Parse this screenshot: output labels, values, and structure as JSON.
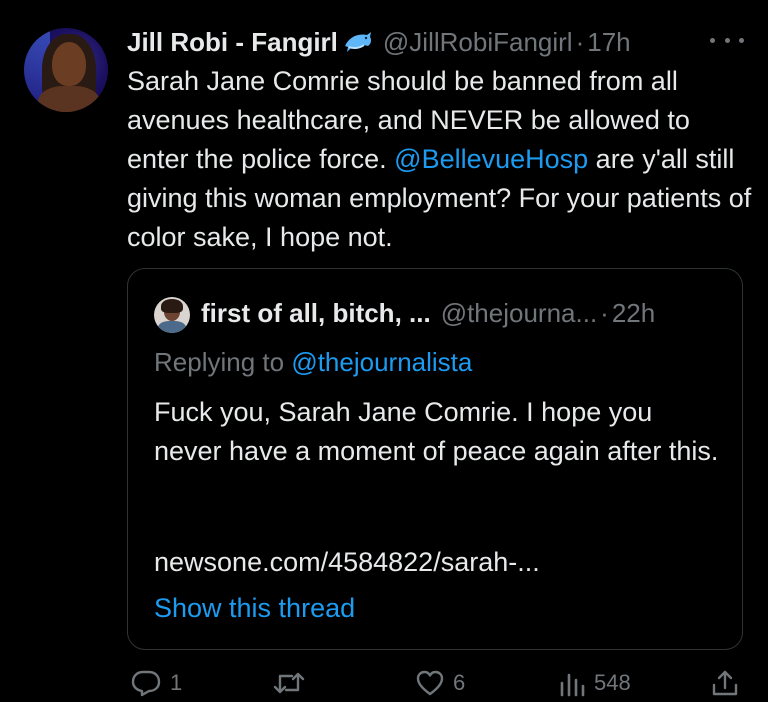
{
  "tweet": {
    "author_name": "Jill Robi - Fangirl",
    "name_emoji": "dolphin-icon",
    "handle": "@JillRobiFangirl",
    "separator": "·",
    "time": "17h",
    "text_before": "Sarah Jane Comrie should be banned from all avenues healthcare, and NEVER be allowed to enter the police force. ",
    "mention": "@BellevueHosp",
    "text_after": " are y'all still giving this woman employment? For your patients of color sake, I hope not."
  },
  "quote": {
    "author_name": "first of all, bitch, ...",
    "handle": "@thejourna...",
    "separator": "·",
    "time": "22h",
    "replying_prefix": "Replying to",
    "replying_to": "@thejournalista",
    "text": "Fuck you, Sarah Jane Comrie. I hope you never have a moment of peace again after this.",
    "link": "newsone.com/4584822/sarah-...",
    "show_thread": "Show this thread"
  },
  "actions": {
    "reply_count": "1",
    "like_count": "6",
    "views_count": "548"
  },
  "colors": {
    "background": "#000000",
    "text": "#e7e9ea",
    "muted": "#71767b",
    "accent": "#1d9bf0",
    "border": "#2f3336"
  }
}
